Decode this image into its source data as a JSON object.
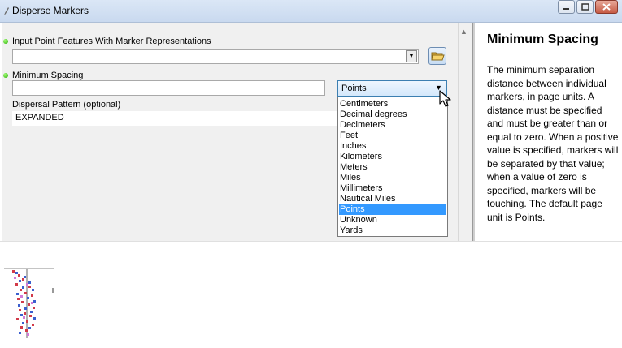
{
  "window": {
    "title": "Disperse Markers"
  },
  "form": {
    "input_features_label": "Input Point Features With Marker Representations",
    "input_features_value": "",
    "min_spacing_label": "Minimum Spacing",
    "min_spacing_value": "",
    "units_selected": "Points",
    "dispersal_label": "Dispersal Pattern (optional)",
    "dispersal_value": "EXPANDED"
  },
  "units_options": [
    "Centimeters",
    "Decimal degrees",
    "Decimeters",
    "Feet",
    "Inches",
    "Kilometers",
    "Meters",
    "Miles",
    "Millimeters",
    "Nautical Miles",
    "Points",
    "Unknown",
    "Yards"
  ],
  "help": {
    "title": "Minimum Spacing",
    "text": "The minimum separation distance between individual markers, in page units. A distance must be specified and must be greater than or equal to zero. When a positive value is specified, markers will be separated by that value; when a value of zero is specified, markers will be touching. The default page unit is Points."
  },
  "icons": {
    "app": "pencil-icon",
    "browse": "folder-open-icon",
    "dropdown": "chevron-down-icon",
    "required": "green-dot-icon",
    "cursor": "mouse-pointer-icon"
  },
  "colors": {
    "selection": "#3399ff",
    "required_dot": "#22a800",
    "title_bar": "#c9d9ef"
  }
}
